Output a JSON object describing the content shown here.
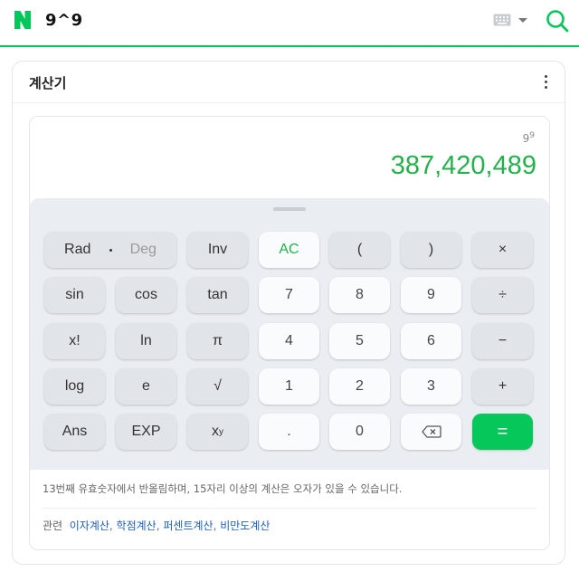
{
  "search": {
    "query": "9^9",
    "logo_letter": "N"
  },
  "card": {
    "title": "계산기"
  },
  "calculator": {
    "expression_base": "9",
    "expression_exp": "9",
    "result": "387,420,489",
    "keys": {
      "rad": "Rad",
      "deg": "Deg",
      "inv": "Inv",
      "ac": "AC",
      "lparen": "(",
      "rparen": ")",
      "multiply": "×",
      "sin": "sin",
      "cos": "cos",
      "tan": "tan",
      "seven": "7",
      "eight": "8",
      "nine": "9",
      "divide": "÷",
      "factorial": "x!",
      "ln": "ln",
      "pi": "π",
      "four": "4",
      "five": "5",
      "six": "6",
      "minus": "−",
      "log": "log",
      "e": "e",
      "sqrt": "√",
      "one": "1",
      "two": "2",
      "three": "3",
      "plus": "+",
      "ans": "Ans",
      "exp": "EXP",
      "xy_base": "x",
      "xy_exp": "y",
      "dot": ".",
      "zero": "0",
      "equals": "="
    },
    "notice": "13번째 유효숫자에서 반올림하며, 15자리 이상의 계산은 오자가 있을 수 있습니다.",
    "related_label": "관련",
    "related_links": [
      "이자계산",
      "학점계산",
      "퍼센트계산",
      "비만도계산"
    ]
  },
  "colors": {
    "brand": "#03c75a",
    "result": "#23b24a",
    "equals_key": "#05c75a",
    "link": "#1e5fb8"
  },
  "icons": {
    "logo": "naver-n-icon",
    "keyboard": "keyboard-icon",
    "dropdown": "chevron-down-icon",
    "search": "search-icon",
    "more": "more-vertical-icon",
    "backspace": "backspace-icon"
  }
}
